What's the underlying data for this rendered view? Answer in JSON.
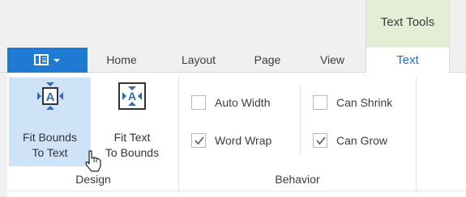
{
  "context_tab": {
    "label": "Text Tools",
    "color": "#e4eed7"
  },
  "app_menu": {
    "icon": "layout-panel-icon",
    "color": "#1f7bd1"
  },
  "tabs": [
    {
      "label": "Home",
      "active": false
    },
    {
      "label": "Layout",
      "active": false
    },
    {
      "label": "Page",
      "active": false
    },
    {
      "label": "View",
      "active": false
    },
    {
      "label": "Text",
      "active": true
    }
  ],
  "groups": {
    "design": {
      "label": "Design",
      "buttons": [
        {
          "line1": "Fit Bounds",
          "line2": "To Text",
          "icon": "fit-bounds-to-text-icon",
          "state": "hovered"
        },
        {
          "line1": "Fit Text",
          "line2": "To Bounds",
          "icon": "fit-text-to-bounds-icon",
          "state": "normal"
        }
      ]
    },
    "behavior": {
      "label": "Behavior",
      "options": [
        {
          "label": "Auto Width",
          "checked": false
        },
        {
          "label": "Can Shrink",
          "checked": false
        },
        {
          "label": "Word Wrap",
          "checked": true
        },
        {
          "label": "Can Grow",
          "checked": true
        }
      ]
    }
  },
  "colors": {
    "accent": "#1f7bd1",
    "active_tab_text": "#1f6fc5",
    "hover": "#cfe3f8",
    "icon": "#2f6fae"
  }
}
